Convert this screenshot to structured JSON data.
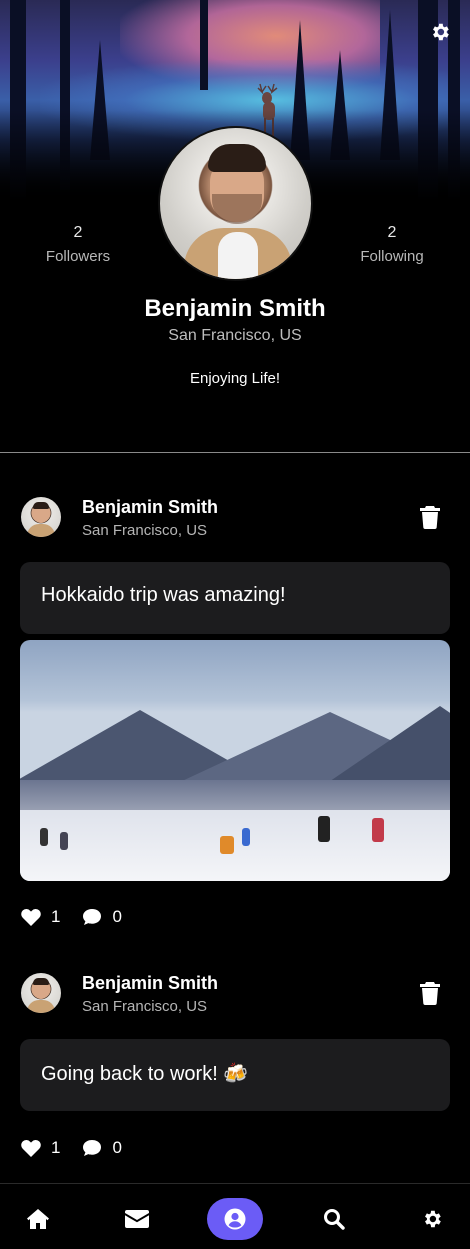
{
  "profile": {
    "name": "Benjamin Smith",
    "location": "San Francisco, US",
    "bio": "Enjoying Life!",
    "followers": {
      "count": "2",
      "label": "Followers"
    },
    "following": {
      "count": "2",
      "label": "Following"
    }
  },
  "posts": [
    {
      "author": "Benjamin Smith",
      "location": "San Francisco, US",
      "text": "Hokkaido trip was amazing!",
      "has_image": true,
      "likes": "1",
      "comments": "0"
    },
    {
      "author": "Benjamin Smith",
      "location": "San Francisco, US",
      "text": "Going back to work! 🍻",
      "has_image": false,
      "likes": "1",
      "comments": "0"
    }
  ],
  "nav": {
    "items": [
      "home-icon",
      "mail-icon",
      "profile-icon",
      "search-icon",
      "gear-icon"
    ],
    "active": "profile-icon"
  },
  "colors": {
    "background": "#000000",
    "card": "#1c1c1e",
    "accent": "#6b5cf6",
    "text_secondary": "#b5b5b5"
  }
}
